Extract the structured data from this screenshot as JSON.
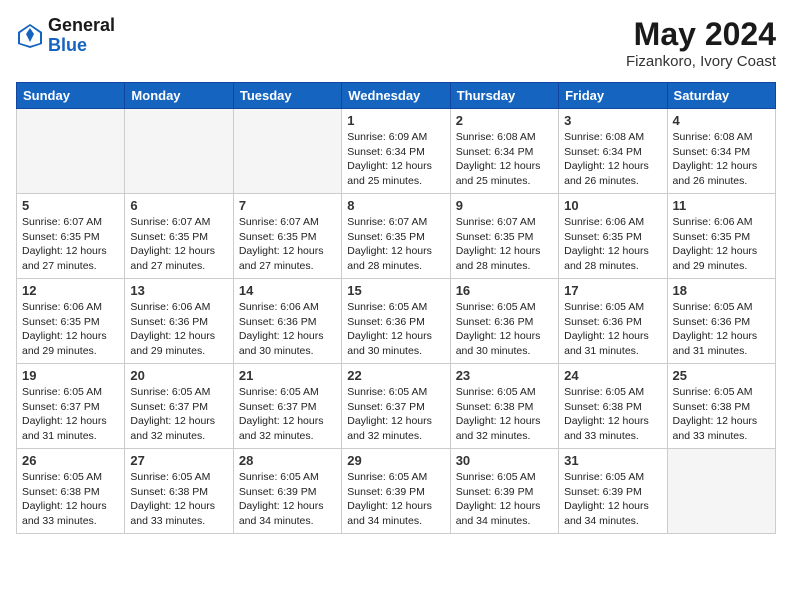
{
  "logo": {
    "general": "General",
    "blue": "Blue"
  },
  "title": "May 2024",
  "subtitle": "Fizankoro, Ivory Coast",
  "days_header": [
    "Sunday",
    "Monday",
    "Tuesday",
    "Wednesday",
    "Thursday",
    "Friday",
    "Saturday"
  ],
  "weeks": [
    [
      {
        "num": "",
        "info": ""
      },
      {
        "num": "",
        "info": ""
      },
      {
        "num": "",
        "info": ""
      },
      {
        "num": "1",
        "info": "Sunrise: 6:09 AM\nSunset: 6:34 PM\nDaylight: 12 hours\nand 25 minutes."
      },
      {
        "num": "2",
        "info": "Sunrise: 6:08 AM\nSunset: 6:34 PM\nDaylight: 12 hours\nand 25 minutes."
      },
      {
        "num": "3",
        "info": "Sunrise: 6:08 AM\nSunset: 6:34 PM\nDaylight: 12 hours\nand 26 minutes."
      },
      {
        "num": "4",
        "info": "Sunrise: 6:08 AM\nSunset: 6:34 PM\nDaylight: 12 hours\nand 26 minutes."
      }
    ],
    [
      {
        "num": "5",
        "info": "Sunrise: 6:07 AM\nSunset: 6:35 PM\nDaylight: 12 hours\nand 27 minutes."
      },
      {
        "num": "6",
        "info": "Sunrise: 6:07 AM\nSunset: 6:35 PM\nDaylight: 12 hours\nand 27 minutes."
      },
      {
        "num": "7",
        "info": "Sunrise: 6:07 AM\nSunset: 6:35 PM\nDaylight: 12 hours\nand 27 minutes."
      },
      {
        "num": "8",
        "info": "Sunrise: 6:07 AM\nSunset: 6:35 PM\nDaylight: 12 hours\nand 28 minutes."
      },
      {
        "num": "9",
        "info": "Sunrise: 6:07 AM\nSunset: 6:35 PM\nDaylight: 12 hours\nand 28 minutes."
      },
      {
        "num": "10",
        "info": "Sunrise: 6:06 AM\nSunset: 6:35 PM\nDaylight: 12 hours\nand 28 minutes."
      },
      {
        "num": "11",
        "info": "Sunrise: 6:06 AM\nSunset: 6:35 PM\nDaylight: 12 hours\nand 29 minutes."
      }
    ],
    [
      {
        "num": "12",
        "info": "Sunrise: 6:06 AM\nSunset: 6:35 PM\nDaylight: 12 hours\nand 29 minutes."
      },
      {
        "num": "13",
        "info": "Sunrise: 6:06 AM\nSunset: 6:36 PM\nDaylight: 12 hours\nand 29 minutes."
      },
      {
        "num": "14",
        "info": "Sunrise: 6:06 AM\nSunset: 6:36 PM\nDaylight: 12 hours\nand 30 minutes."
      },
      {
        "num": "15",
        "info": "Sunrise: 6:05 AM\nSunset: 6:36 PM\nDaylight: 12 hours\nand 30 minutes."
      },
      {
        "num": "16",
        "info": "Sunrise: 6:05 AM\nSunset: 6:36 PM\nDaylight: 12 hours\nand 30 minutes."
      },
      {
        "num": "17",
        "info": "Sunrise: 6:05 AM\nSunset: 6:36 PM\nDaylight: 12 hours\nand 31 minutes."
      },
      {
        "num": "18",
        "info": "Sunrise: 6:05 AM\nSunset: 6:36 PM\nDaylight: 12 hours\nand 31 minutes."
      }
    ],
    [
      {
        "num": "19",
        "info": "Sunrise: 6:05 AM\nSunset: 6:37 PM\nDaylight: 12 hours\nand 31 minutes."
      },
      {
        "num": "20",
        "info": "Sunrise: 6:05 AM\nSunset: 6:37 PM\nDaylight: 12 hours\nand 32 minutes."
      },
      {
        "num": "21",
        "info": "Sunrise: 6:05 AM\nSunset: 6:37 PM\nDaylight: 12 hours\nand 32 minutes."
      },
      {
        "num": "22",
        "info": "Sunrise: 6:05 AM\nSunset: 6:37 PM\nDaylight: 12 hours\nand 32 minutes."
      },
      {
        "num": "23",
        "info": "Sunrise: 6:05 AM\nSunset: 6:38 PM\nDaylight: 12 hours\nand 32 minutes."
      },
      {
        "num": "24",
        "info": "Sunrise: 6:05 AM\nSunset: 6:38 PM\nDaylight: 12 hours\nand 33 minutes."
      },
      {
        "num": "25",
        "info": "Sunrise: 6:05 AM\nSunset: 6:38 PM\nDaylight: 12 hours\nand 33 minutes."
      }
    ],
    [
      {
        "num": "26",
        "info": "Sunrise: 6:05 AM\nSunset: 6:38 PM\nDaylight: 12 hours\nand 33 minutes."
      },
      {
        "num": "27",
        "info": "Sunrise: 6:05 AM\nSunset: 6:38 PM\nDaylight: 12 hours\nand 33 minutes."
      },
      {
        "num": "28",
        "info": "Sunrise: 6:05 AM\nSunset: 6:39 PM\nDaylight: 12 hours\nand 34 minutes."
      },
      {
        "num": "29",
        "info": "Sunrise: 6:05 AM\nSunset: 6:39 PM\nDaylight: 12 hours\nand 34 minutes."
      },
      {
        "num": "30",
        "info": "Sunrise: 6:05 AM\nSunset: 6:39 PM\nDaylight: 12 hours\nand 34 minutes."
      },
      {
        "num": "31",
        "info": "Sunrise: 6:05 AM\nSunset: 6:39 PM\nDaylight: 12 hours\nand 34 minutes."
      },
      {
        "num": "",
        "info": ""
      }
    ]
  ]
}
